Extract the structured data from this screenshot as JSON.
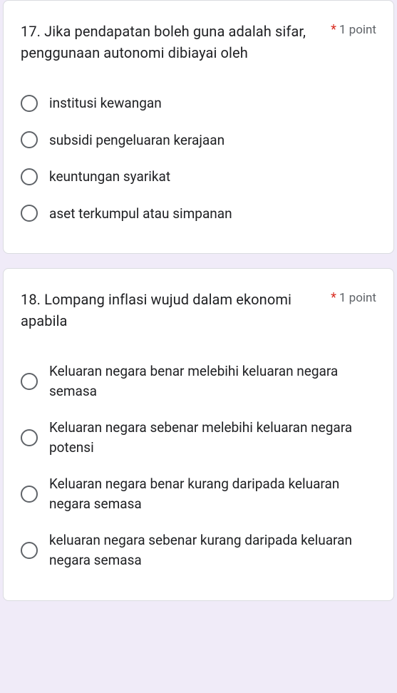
{
  "questions": [
    {
      "title": "17. Jika pendapatan boleh guna adalah sifar, penggunaan autonomi dibiayai oleh",
      "required": "*",
      "points": "1 point",
      "options": [
        "institusi kewangan",
        "subsidi pengeluaran kerajaan",
        "keuntungan syarikat",
        "aset terkumpul atau simpanan"
      ]
    },
    {
      "title": "18. Lompang inflasi wujud dalam ekonomi apabila",
      "required": "*",
      "points": "1 point",
      "options": [
        "Keluaran negara benar melebihi keluaran negara semasa",
        "Keluaran negara sebenar melebihi keluaran negara potensi",
        "Keluaran negara benar kurang daripada keluaran negara semasa",
        "keluaran negara sebenar kurang daripada keluaran negara semasa"
      ]
    }
  ]
}
